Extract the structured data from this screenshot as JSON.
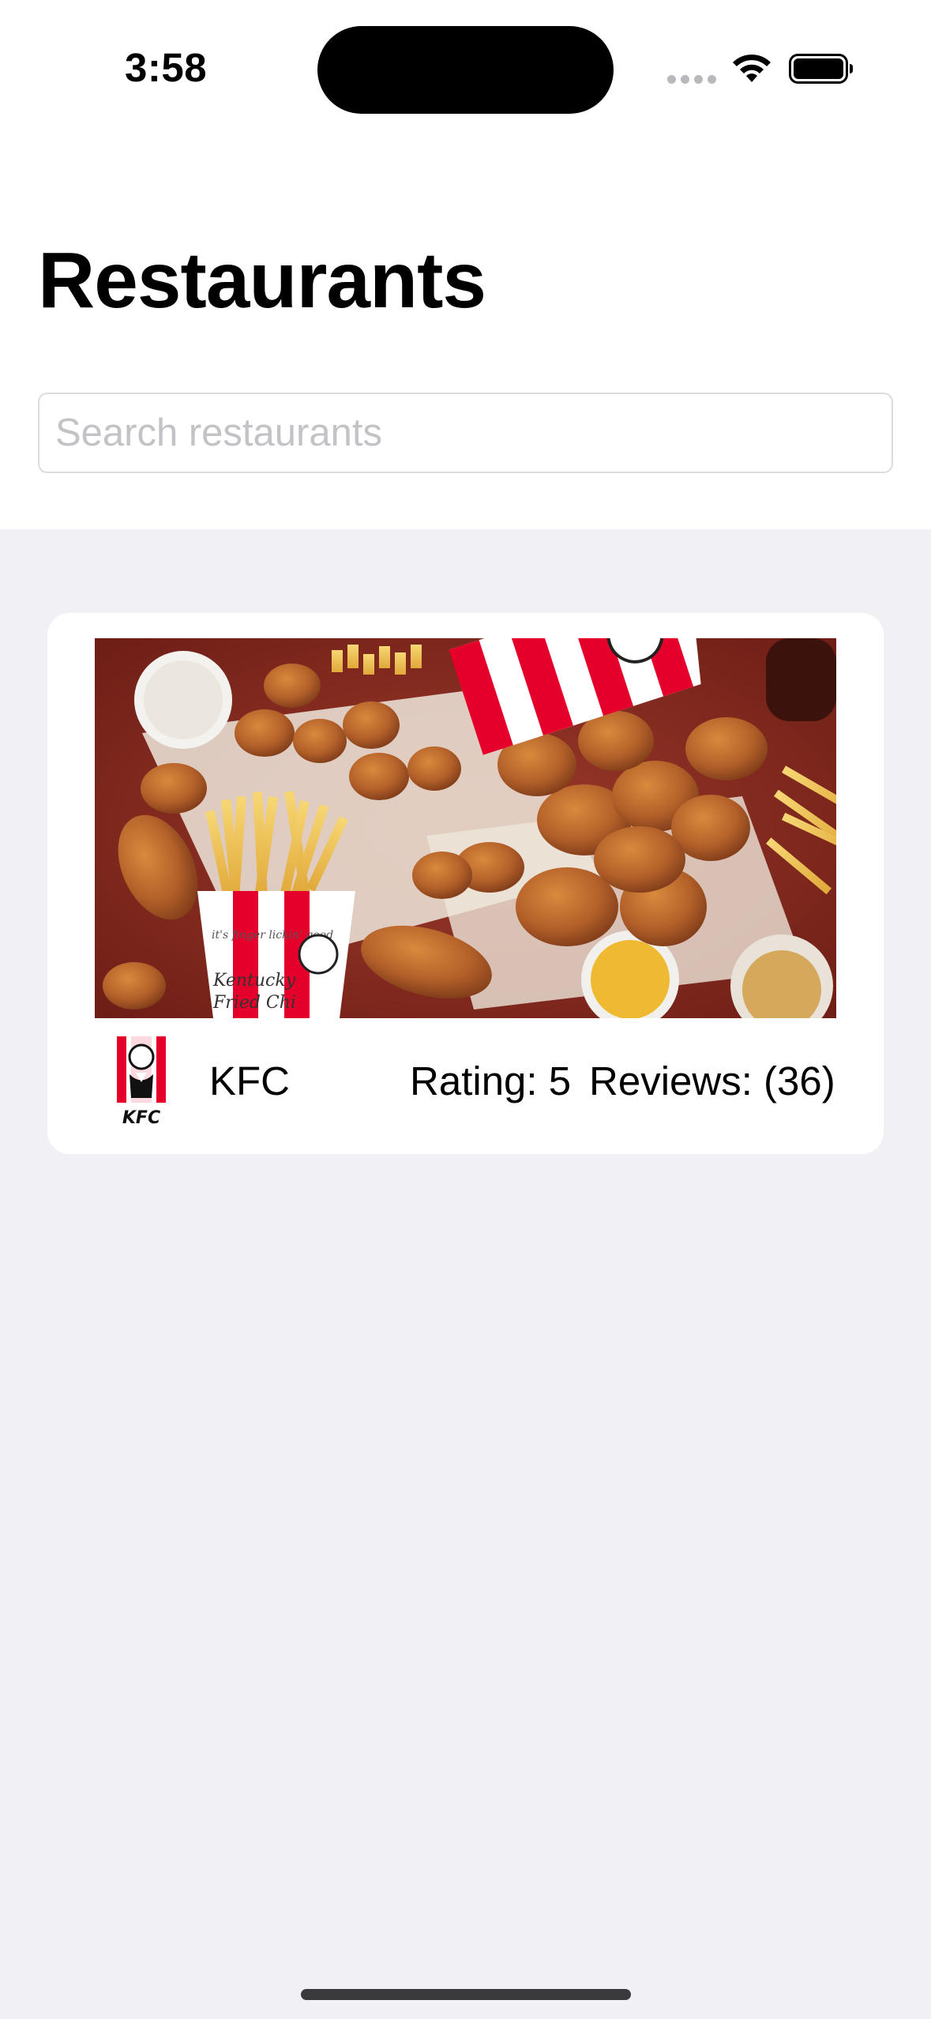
{
  "status_bar": {
    "time": "3:58",
    "icons": [
      "cellular-dots-icon",
      "wifi-icon",
      "battery-icon"
    ]
  },
  "header": {
    "title": "Restaurants"
  },
  "search": {
    "placeholder": "Search restaurants",
    "value": ""
  },
  "restaurants": [
    {
      "name": "KFC",
      "rating": "Rating: 5",
      "reviews": "Reviews: (36)",
      "image": "fried-chicken-photo",
      "logo": "kfc-logo",
      "logo_text": "KFC",
      "image_text": [
        "Kentucky",
        "Fried Chi",
        "it's finger lickin' good"
      ]
    }
  ],
  "colors": {
    "background": "#f1f0f5",
    "card": "#ffffff",
    "placeholder": "#c3c3c7",
    "kfc_red": "#e4002b"
  }
}
